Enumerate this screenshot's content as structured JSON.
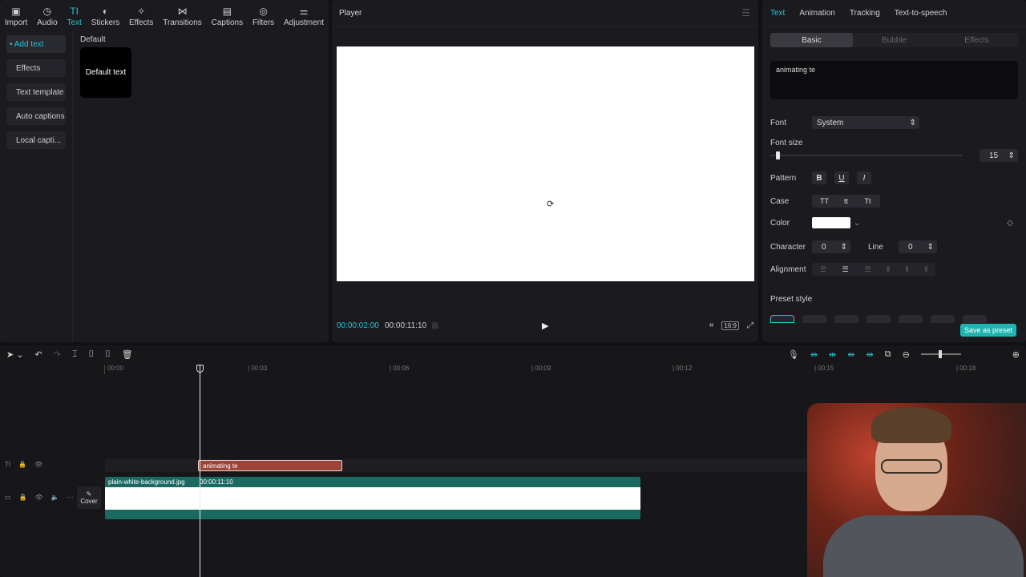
{
  "toolbar": {
    "items": [
      {
        "label": "Import",
        "icon": "import-icon"
      },
      {
        "label": "Audio",
        "icon": "audio-icon"
      },
      {
        "label": "Text",
        "icon": "text-icon"
      },
      {
        "label": "Stickers",
        "icon": "stickers-icon"
      },
      {
        "label": "Effects",
        "icon": "effects-icon"
      },
      {
        "label": "Transitions",
        "icon": "transitions-icon"
      },
      {
        "label": "Captions",
        "icon": "captions-icon"
      },
      {
        "label": "Filters",
        "icon": "filters-icon"
      },
      {
        "label": "Adjustment",
        "icon": "adjustment-icon"
      }
    ],
    "active": "Text"
  },
  "sidebar": {
    "items": [
      {
        "label": "• Add text"
      },
      {
        "label": "Effects"
      },
      {
        "label": "Text template"
      },
      {
        "label": "Auto captions"
      },
      {
        "label": "Local capti..."
      }
    ]
  },
  "library": {
    "section_title": "Default",
    "card_label": "Default text"
  },
  "player": {
    "title": "Player",
    "current_time": "00:00:02:00",
    "total_time": "00:00:11:10",
    "ratio_label": "16:9"
  },
  "props": {
    "tabs": [
      "Text",
      "Animation",
      "Tracking",
      "Text-to-speech"
    ],
    "subtabs": [
      "Basic",
      "Bubble",
      "Effects"
    ],
    "text_value": "animating te",
    "font_label": "Font",
    "font_value": "System",
    "font_size_label": "Font size",
    "font_size_value": "15",
    "pattern_label": "Pattern",
    "pattern_buttons": [
      "B",
      "U",
      "I"
    ],
    "case_label": "Case",
    "case_buttons": [
      "TT",
      "tt",
      "Tt"
    ],
    "color_label": "Color",
    "color_value": "#ffffff",
    "character_label": "Character",
    "character_value": "0",
    "line_label": "Line",
    "line_value": "0",
    "alignment_label": "Alignment",
    "preset_label": "Preset style",
    "save_preset_label": "Save as preset"
  },
  "timeline": {
    "ruler": [
      "00:00",
      "| 00:03",
      "| 00:06",
      "| 00:09",
      "| 00:12",
      "| 00:15",
      "| 00:18"
    ],
    "text_clip_label": "animating te",
    "video_clip_name": "plain-white-background.jpg",
    "video_clip_duration": "00:00:11:10",
    "cover_label": "Cover"
  },
  "colors": {
    "accent": "#25c6d6",
    "text_clip": "#9b4437",
    "video_clip": "#1a6a62",
    "save_button": "#20b4b0"
  }
}
